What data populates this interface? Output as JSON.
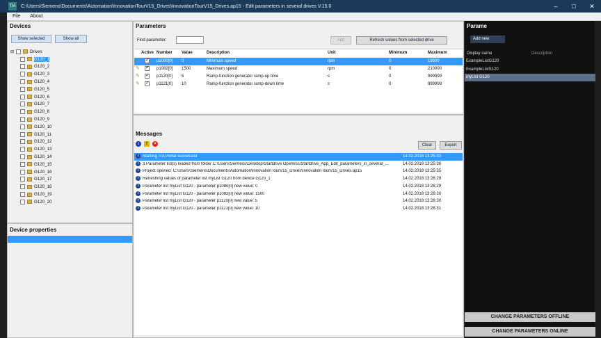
{
  "window": {
    "title": "C:\\Users\\Siemens\\Documents\\Automation\\InnovationTourV15_Drives\\InnovationTourV15_Drives.ap15 - Edit parameters in several drives V.15.0",
    "app_icon": "TIA"
  },
  "menu": [
    "File",
    "About"
  ],
  "devices": {
    "header": "Devices",
    "show_selected": "Show selected",
    "show_all": "Show all",
    "root_label": "Drives",
    "items": [
      "G120_1",
      "G120_2",
      "G120_3",
      "G120_4",
      "G120_5",
      "G120_6",
      "G120_7",
      "G120_8",
      "G120_9",
      "G120_10",
      "G120_11",
      "G120_12",
      "G120_13",
      "G120_14",
      "G120_15",
      "G120_16",
      "G120_17",
      "G120_18",
      "G120_19",
      "G120_20"
    ]
  },
  "device_properties": {
    "header": "Device properties"
  },
  "parameters": {
    "header": "Parameters",
    "find_label": "Find parameter:",
    "find_value": "",
    "add_label": "Add",
    "refresh_label": "Refresh values from selected drive",
    "columns": {
      "active": "Active",
      "number": "Number",
      "value": "Value",
      "description": "Description",
      "unit": "Unit",
      "minimum": "Minimum",
      "maximum": "Maximum"
    },
    "rows": [
      {
        "number": "p1080[0]",
        "value": "0",
        "description": "Minimum speed",
        "unit": "rpm",
        "minimum": "0",
        "maximum": "19500",
        "active": true
      },
      {
        "number": "p1082[0]",
        "value": "1500",
        "description": "Maximum speed",
        "unit": "rpm",
        "minimum": "0",
        "maximum": "210000",
        "active": true
      },
      {
        "number": "p1120[0]",
        "value": "5",
        "description": "Ramp-function generator ramp-up time",
        "unit": "s",
        "minimum": "0",
        "maximum": "999999",
        "active": true
      },
      {
        "number": "p1121[0]",
        "value": "10",
        "description": "Ramp-function generator ramp-down time",
        "unit": "s",
        "minimum": "0",
        "maximum": "999999",
        "active": true
      }
    ]
  },
  "messages": {
    "header": "Messages",
    "clear_label": "Clear",
    "export_label": "Export",
    "rows": [
      {
        "text": "Starting TIA Portal successful",
        "time": "14.02.2018 13:25:33"
      },
      {
        "text": "3 Parameter list(s) loaded from folder C:\\Users\\Siemens\\Desktop\\Startdrive Openess\\Startdrive_App_Edit_parameters_in_several_...",
        "time": "14.02.2018 13:25:38"
      },
      {
        "text": "Project opened: C:\\Users\\Siemens\\Documents\\Automation\\InnovationTourV15_Drives\\InnovationTourV15_Drives.ap15",
        "time": "14.02.2018 13:25:55"
      },
      {
        "text": "Refreshing values of parameter list myList G120 from device G120_1",
        "time": "14.02.2018 13:26:29"
      },
      {
        "text": "Parameter list myList G120 - parameter p1080[0] new value: 0",
        "time": "14.02.2018 13:26:29"
      },
      {
        "text": "Parameter list myList G120 - parameter p1082[0] new value: 1500",
        "time": "14.02.2018 13:26:30"
      },
      {
        "text": "Parameter list myList G120 - parameter p1120[0] new value: 5",
        "time": "14.02.2018 13:26:30"
      },
      {
        "text": "Parameter list myList G120 - parameter p1121[0] new value: 10",
        "time": "14.02.2018 13:26:31"
      }
    ]
  },
  "param_lists": {
    "header": "Parame",
    "add_new": "Add new",
    "col_display": "Display name",
    "col_description": "Description",
    "items": [
      "ExampleListG120",
      "ExampleListS120",
      "myList G120"
    ]
  },
  "actions": {
    "offline": "CHANGE PARAMETERS OFFLINE",
    "online": "CHANGE PARAMETERS ONLINE"
  }
}
